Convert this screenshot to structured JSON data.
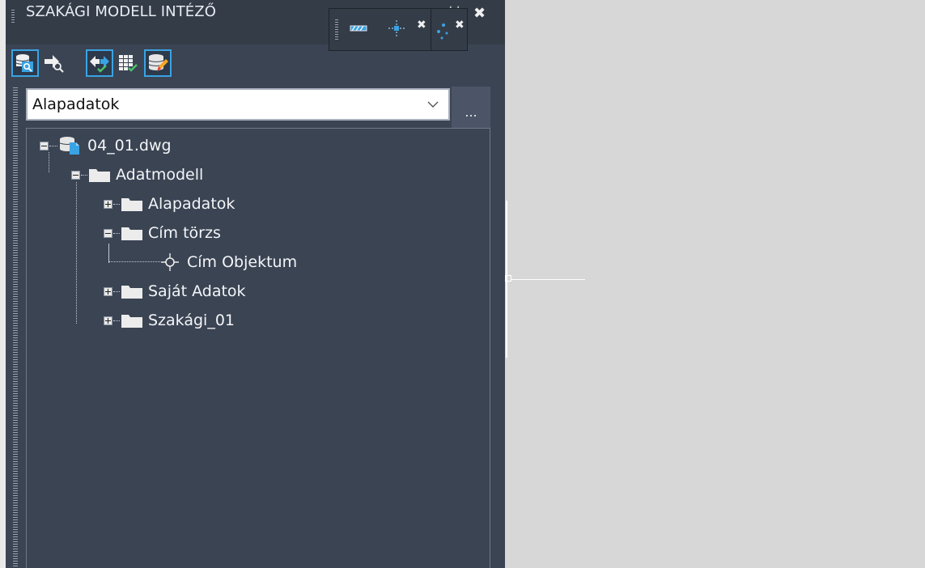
{
  "panel": {
    "title": "SZAKÁGI MODELL INTÉZŐ"
  },
  "toolbar_icons": [
    {
      "name": "database-search-icon",
      "active": true
    },
    {
      "name": "arrow-search-icon",
      "active": false
    },
    {
      "name": "compare-check-icon",
      "active": true
    },
    {
      "name": "grid-check-icon",
      "active": false
    },
    {
      "name": "database-edit-icon",
      "active": true
    }
  ],
  "dropdown": {
    "selected": "Alapadatok",
    "more_label": "..."
  },
  "tree": {
    "root": "04_01.dwg",
    "model": "Adatmodell",
    "folder_alapadatok": "Alapadatok",
    "folder_cim_torzs": "Cím törzs",
    "object_cim": "Cím Objektum",
    "folder_sajat": "Saját Adatok",
    "folder_szakagi": "Szakági_01"
  },
  "colors": {
    "panel_bg": "#3b4453",
    "accent": "#3aa3e3",
    "canvas_bg": "#d7d7d7"
  }
}
